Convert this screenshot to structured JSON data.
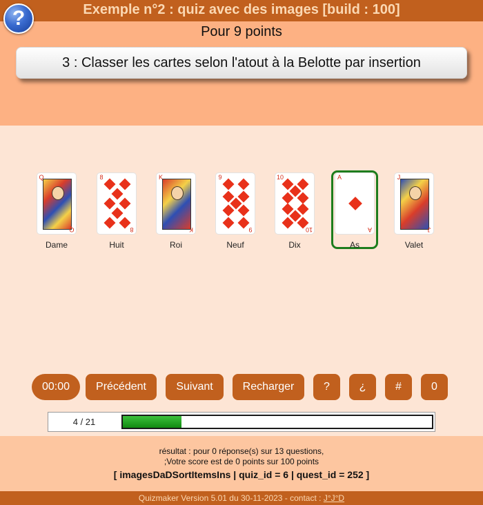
{
  "app": {
    "title": "Exemple n°2 : quiz avec des images [build : 100]",
    "help_icon": "?"
  },
  "question": {
    "points": "Pour 9 points",
    "text": "3 : Classer les cartes selon l'atout à la Belotte par insertion"
  },
  "cards": [
    {
      "label": "Dame",
      "rank": "Q",
      "type": "face",
      "selected": false
    },
    {
      "label": "Huit",
      "rank": "8",
      "type": "eight",
      "selected": false
    },
    {
      "label": "Roi",
      "rank": "K",
      "type": "face",
      "selected": false
    },
    {
      "label": "Neuf",
      "rank": "9",
      "type": "nine",
      "selected": false
    },
    {
      "label": "Dix",
      "rank": "10",
      "type": "ten",
      "selected": false
    },
    {
      "label": "As",
      "rank": "A",
      "type": "ace",
      "selected": true
    },
    {
      "label": "Valet",
      "rank": "J",
      "type": "face",
      "selected": false
    }
  ],
  "buttons": {
    "timer": "00:00",
    "previous": "Précédent",
    "next": "Suivant",
    "reload": "Recharger",
    "help": "?",
    "inverse_help": "¿",
    "hash": "#",
    "zero": "0"
  },
  "progress": {
    "label": "4 / 21",
    "fraction": 0.19
  },
  "result": {
    "line1": "résultat : pour 0 réponse(s) sur 13 questions,",
    "line2": ";Votre score est de 0 points sur 100 points",
    "ids": "[ imagesDaDSortItemsIns | quiz_id = 6 | quest_id = 252 ]"
  },
  "footer": {
    "text": "Quizmaker Version 5.01 du 30-11-2023 - contact : ",
    "contact": "J°J°D"
  },
  "colors": {
    "brand": "#c1601e",
    "header_bg": "#fdb183",
    "body_bg": "#fde5d5",
    "selected_border": "#1d7d1d",
    "progress_fill": "#1fa01f"
  }
}
